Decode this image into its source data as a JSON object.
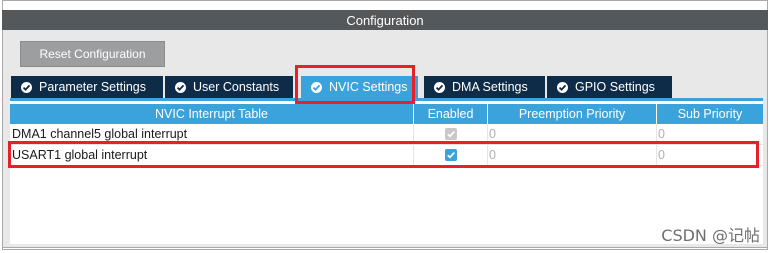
{
  "window": {
    "title": "Configuration"
  },
  "toolbar": {
    "reset_label": "Reset Configuration"
  },
  "tabs": [
    {
      "label": "Parameter Settings",
      "icon": "check-circle-icon",
      "active": false
    },
    {
      "label": "User Constants",
      "icon": "check-circle-icon",
      "active": false
    },
    {
      "label": "NVIC Settings",
      "icon": "check-circle-icon",
      "active": true
    },
    {
      "label": "DMA Settings",
      "icon": "check-circle-icon",
      "active": false
    },
    {
      "label": "GPIO Settings",
      "icon": "check-circle-icon",
      "active": false
    }
  ],
  "table": {
    "columns": [
      "NVIC Interrupt Table",
      "Enabled",
      "Preemption Priority",
      "Sub Priority"
    ],
    "rows": [
      {
        "name": "DMA1 channel5 global interrupt",
        "enabled": true,
        "editable": false,
        "preemption": "0",
        "sub": "0"
      },
      {
        "name": "USART1 global interrupt",
        "enabled": true,
        "editable": true,
        "preemption": "0",
        "sub": "0"
      }
    ]
  },
  "watermark": "CSDN @记帖",
  "colors": {
    "accent": "#3ba3dc",
    "tab_bg": "#0e2b48",
    "title_bar": "#55585a",
    "highlight": "#e8202a"
  }
}
